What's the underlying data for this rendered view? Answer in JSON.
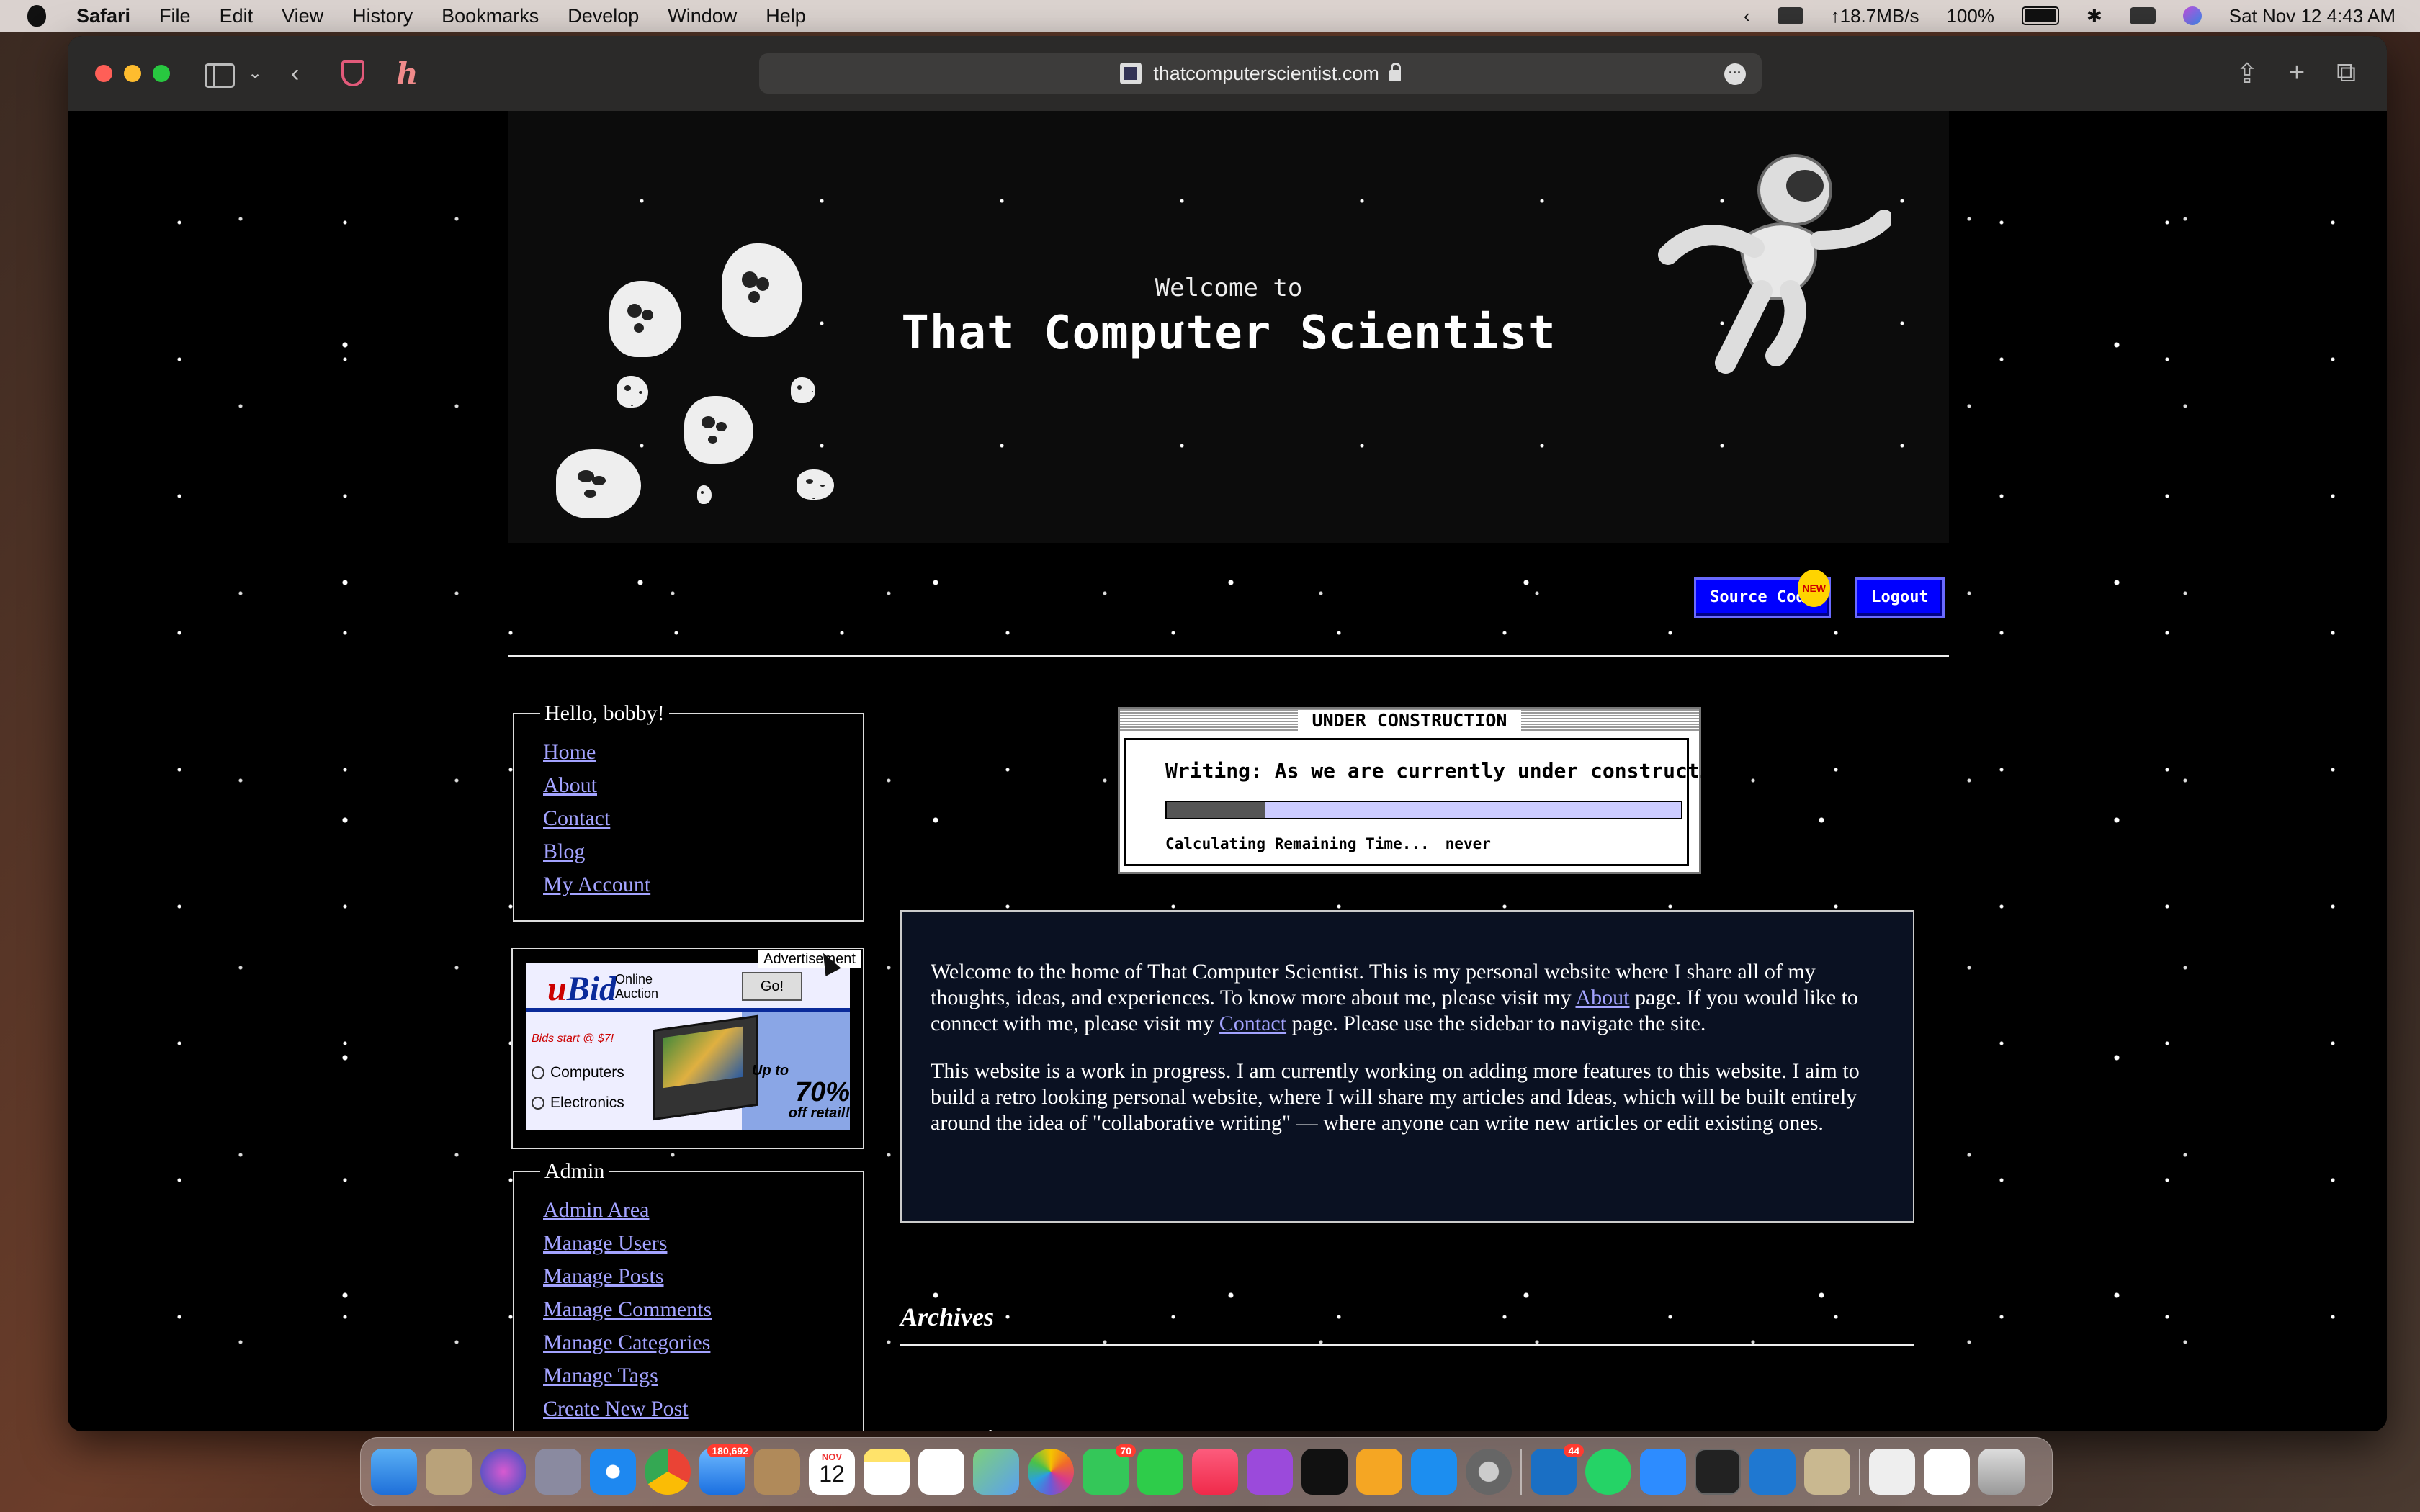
{
  "menubar": {
    "app": "Safari",
    "items": [
      "File",
      "Edit",
      "View",
      "History",
      "Bookmarks",
      "Develop",
      "Window",
      "Help"
    ],
    "network_speed": "↑18.7MB/s",
    "battery": "100%",
    "datetime": "Sat Nov 12  4:43 AM"
  },
  "browser": {
    "url": "thatcomputerscientist.com"
  },
  "banner": {
    "subtitle": "Welcome to",
    "title": "That Computer Scientist"
  },
  "topnav": {
    "source_code": "Source Code",
    "new_badge": "NEW",
    "logout": "Logout"
  },
  "user_box": {
    "legend": "Hello, bobby!",
    "links": [
      "Home",
      "About",
      "Contact",
      "Blog",
      "My Account"
    ]
  },
  "ad": {
    "label": "Advertisement",
    "brand": "uBid",
    "tagline_1": "Online",
    "tagline_2": "Auction",
    "go": "Go!",
    "bids": "Bids start @ $7!",
    "option_1": "Computers",
    "option_2": "Electronics",
    "promo_a": "Up to",
    "promo_b": "70%",
    "promo_c": "off retail!"
  },
  "admin_box": {
    "legend": "Admin",
    "links": [
      "Admin Area",
      "Manage Users",
      "Manage Posts",
      "Manage Comments",
      "Manage Categories",
      "Manage Tags",
      "Create New Post"
    ]
  },
  "construction": {
    "title": "UNDER CONSTRUCTION",
    "text": "Writing: As we are currently under construction.",
    "progress": 0.19,
    "status_label": "Calculating Remaining Time...",
    "status_value": "never"
  },
  "welcome": {
    "p1_a": "Welcome to the home of That Computer Scientist. This is my personal website where I share all of my thoughts, ideas, and experiences. To know more about me, please visit my ",
    "p1_link1": "About",
    "p1_b": " page. If you would like to connect with me, please visit my ",
    "p1_link2": "Contact",
    "p1_c": " page. Please use the sidebar to navigate the site.",
    "p2": "This website is a work in progress. I am currently working on adding more features to this website. I aim to build a retro looking personal website, where I will share my articles and Ideas, which will be built entirely around the idea of \"collaborative writing\" — where anyone can write new articles or edit existing ones."
  },
  "sections": {
    "archives": "Archives",
    "categories": "Categories"
  },
  "dock": {
    "mail_badge": "180,692",
    "calendar_month": "NOV",
    "calendar_day": "12",
    "messages_badge": "70",
    "outlook_badge": "44"
  }
}
